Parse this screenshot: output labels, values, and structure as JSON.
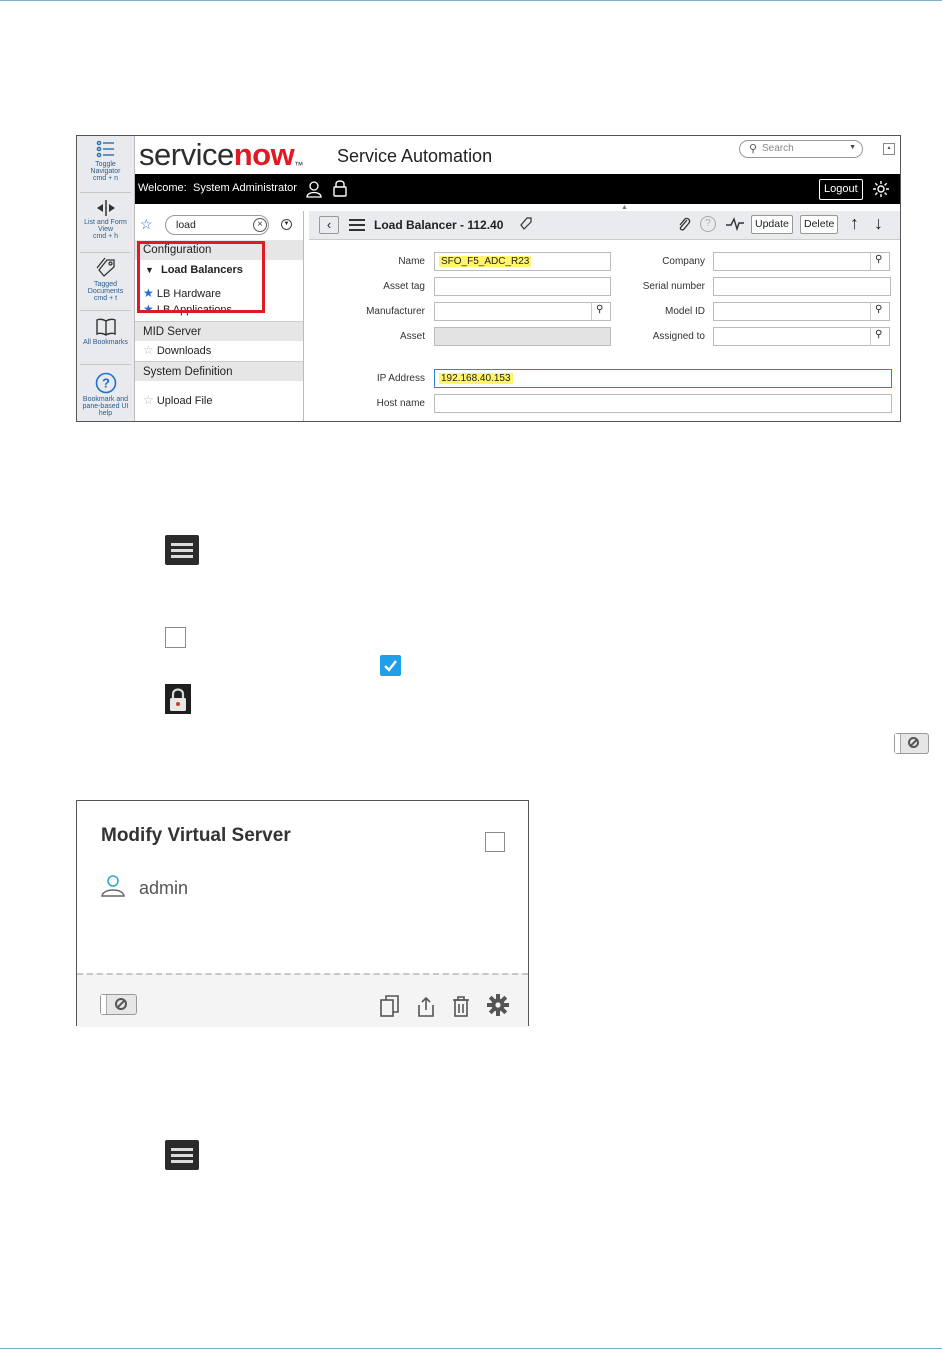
{
  "servicenow": {
    "brand_prefix": "service",
    "brand_suffix": "now",
    "brand_tm": "™",
    "app_title": "Service Automation",
    "search_placeholder": "Search",
    "welcome_label": "Welcome:",
    "welcome_user": "System Administrator",
    "logout": "Logout",
    "left_panel": {
      "toggle_navigator": [
        "Toggle",
        "Navigator",
        "cmd + n"
      ],
      "list_form_view": [
        "List and Form",
        "View",
        "cmd + h"
      ],
      "tagged_documents": [
        "Tagged",
        "Documents",
        "cmd + t"
      ],
      "all_bookmarks": [
        "All Bookmarks"
      ],
      "bookmark_help": [
        "Bookmark and",
        "pane-based UI",
        "help"
      ]
    },
    "nav": {
      "filter_value": "load",
      "sections": [
        {
          "label": "Configuration"
        },
        {
          "label": "MID Server"
        },
        {
          "label": "System Definition"
        }
      ],
      "items": {
        "load_balancers": "Load Balancers",
        "lb_hardware": "LB Hardware",
        "lb_applications": "LB Applications",
        "downloads": "Downloads",
        "upload_file": "Upload File"
      }
    },
    "form": {
      "record_title": "Load Balancer - 112.40",
      "update": "Update",
      "delete": "Delete",
      "fields": {
        "name_label": "Name",
        "name_value": "SFO_F5_ADC_R23",
        "asset_tag_label": "Asset tag",
        "manufacturer_label": "Manufacturer",
        "asset_label": "Asset",
        "ip_label": "IP Address",
        "ip_value": "192.168.40.153",
        "host_label": "Host name",
        "company_label": "Company",
        "serial_label": "Serial number",
        "model_label": "Model ID",
        "assigned_label": "Assigned to"
      }
    }
  },
  "card": {
    "title": "Modify Virtual Server",
    "user": "admin"
  }
}
